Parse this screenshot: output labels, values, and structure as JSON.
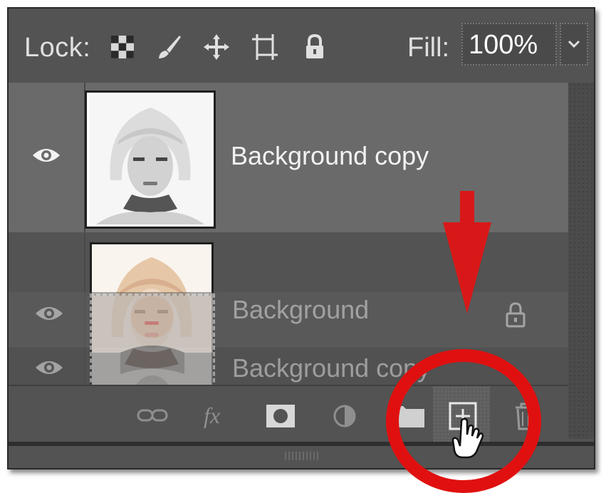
{
  "lock_bar": {
    "lock_label": "Lock:",
    "fill_label": "Fill:",
    "fill_value": "100%"
  },
  "layers": [
    {
      "name": "Background copy",
      "visible": true,
      "selected": true
    },
    {
      "name": "Background",
      "visible": true,
      "locked": true
    }
  ],
  "drag_preview": {
    "names": [
      "Background",
      "Background copy"
    ]
  },
  "bottom_buttons": [
    "link-layers",
    "add-layer-style",
    "add-mask",
    "adjustment-layer",
    "new-group",
    "new-layer",
    "delete-layer"
  ],
  "annotation": {
    "arrow_color": "#e01010",
    "circle_color": "#e01010"
  }
}
